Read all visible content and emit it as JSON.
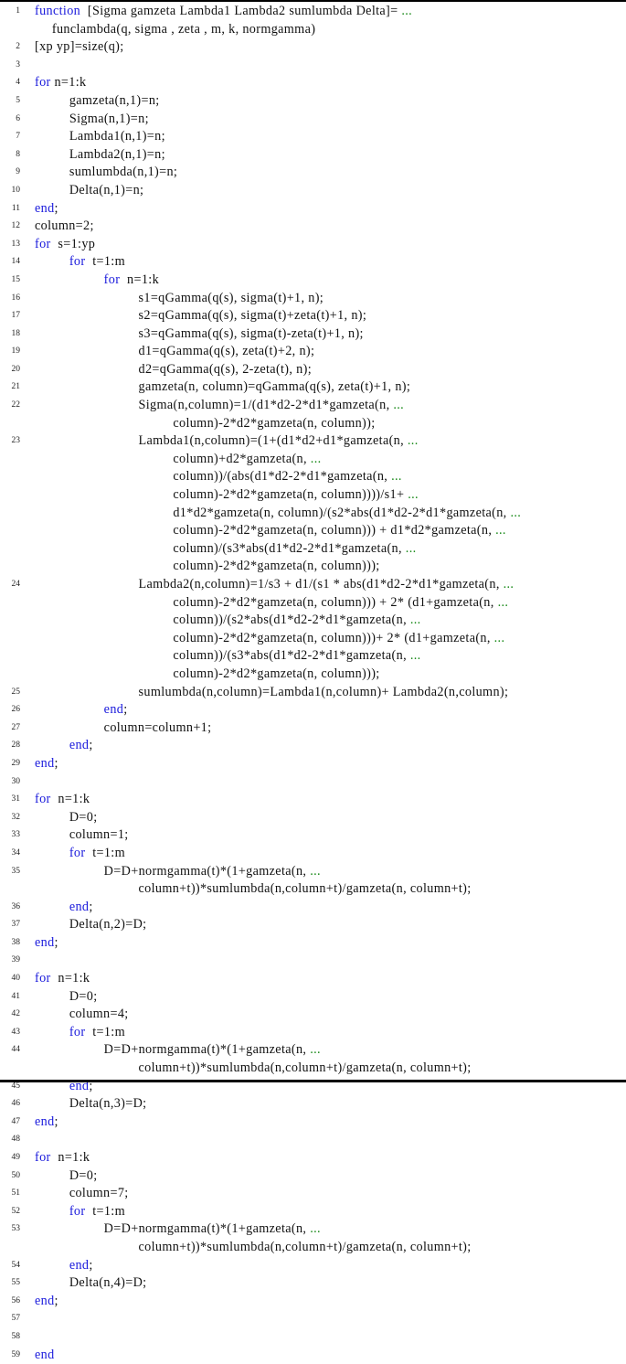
{
  "document": {
    "type": "code-listing",
    "language": "MATLAB",
    "colors": {
      "keyword": "#1a1adc",
      "continuation": "#1a8a1a",
      "text": "#111111"
    },
    "lines": [
      {
        "n": "1",
        "indent": 0,
        "segments": [
          {
            "t": "function",
            "k": "kw"
          },
          {
            "t": "  [Sigma gamzeta Lambda1 Lambda2 sumlumbda Delta]= "
          },
          {
            "t": "...",
            "k": "cont"
          }
        ]
      },
      {
        "n": "",
        "indent": 1,
        "segments": [
          {
            "t": "funclambda(q, sigma , zeta , m, k, normgamma)"
          }
        ]
      },
      {
        "n": "2",
        "indent": 0,
        "segments": [
          {
            "t": "[xp yp]=size(q);"
          }
        ]
      },
      {
        "n": "3",
        "indent": 0,
        "segments": []
      },
      {
        "n": "4",
        "indent": 0,
        "segments": [
          {
            "t": "for",
            "k": "kw"
          },
          {
            "t": " n=1:k"
          }
        ]
      },
      {
        "n": "5",
        "indent": 2,
        "segments": [
          {
            "t": "gamzeta(n,1)=n;"
          }
        ]
      },
      {
        "n": "6",
        "indent": 2,
        "segments": [
          {
            "t": "Sigma(n,1)=n;"
          }
        ]
      },
      {
        "n": "7",
        "indent": 2,
        "segments": [
          {
            "t": "Lambda1(n,1)=n;"
          }
        ]
      },
      {
        "n": "8",
        "indent": 2,
        "segments": [
          {
            "t": "Lambda2(n,1)=n;"
          }
        ]
      },
      {
        "n": "9",
        "indent": 2,
        "segments": [
          {
            "t": "sumlumbda(n,1)=n;"
          }
        ]
      },
      {
        "n": "10",
        "indent": 2,
        "segments": [
          {
            "t": "Delta(n,1)=n;"
          }
        ]
      },
      {
        "n": "11",
        "indent": 0,
        "segments": [
          {
            "t": "end",
            "k": "kw"
          },
          {
            "t": ";"
          }
        ]
      },
      {
        "n": "12",
        "indent": 0,
        "segments": [
          {
            "t": "column=2;"
          }
        ]
      },
      {
        "n": "13",
        "indent": 0,
        "segments": [
          {
            "t": "for",
            "k": "kw"
          },
          {
            "t": "  s=1:yp"
          }
        ]
      },
      {
        "n": "14",
        "indent": 2,
        "segments": [
          {
            "t": "for",
            "k": "kw"
          },
          {
            "t": "  t=1:m"
          }
        ]
      },
      {
        "n": "15",
        "indent": 4,
        "segments": [
          {
            "t": "for",
            "k": "kw"
          },
          {
            "t": "  n=1:k"
          }
        ]
      },
      {
        "n": "16",
        "indent": 6,
        "segments": [
          {
            "t": "s1=qGamma(q(s), sigma(t)+1, n);"
          }
        ]
      },
      {
        "n": "17",
        "indent": 6,
        "segments": [
          {
            "t": "s2=qGamma(q(s), sigma(t)+zeta(t)+1, n);"
          }
        ]
      },
      {
        "n": "18",
        "indent": 6,
        "segments": [
          {
            "t": "s3=qGamma(q(s), sigma(t)-zeta(t)+1, n);"
          }
        ]
      },
      {
        "n": "19",
        "indent": 6,
        "segments": [
          {
            "t": "d1=qGamma(q(s), zeta(t)+2, n);"
          }
        ]
      },
      {
        "n": "20",
        "indent": 6,
        "segments": [
          {
            "t": "d2=qGamma(q(s), 2-zeta(t), n);"
          }
        ]
      },
      {
        "n": "21",
        "indent": 6,
        "segments": [
          {
            "t": "gamzeta(n, column)=qGamma(q(s), zeta(t)+1, n);"
          }
        ]
      },
      {
        "n": "22",
        "indent": 6,
        "segments": [
          {
            "t": "Sigma(n,column)=1/(d1*d2-2*d1*gamzeta(n, "
          },
          {
            "t": "...",
            "k": "cont"
          }
        ]
      },
      {
        "n": "",
        "indent": 8,
        "segments": [
          {
            "t": "column)-2*d2*gamzeta(n, column));"
          }
        ]
      },
      {
        "n": "23",
        "indent": 6,
        "segments": [
          {
            "t": "Lambda1(n,column)=(1+(d1*d2+d1*gamzeta(n, "
          },
          {
            "t": "...",
            "k": "cont"
          }
        ]
      },
      {
        "n": "",
        "indent": 8,
        "segments": [
          {
            "t": "column)+d2*gamzeta(n, "
          },
          {
            "t": "...",
            "k": "cont"
          }
        ]
      },
      {
        "n": "",
        "indent": 8,
        "segments": [
          {
            "t": "column))/(abs(d1*d2-2*d1*gamzeta(n, "
          },
          {
            "t": "...",
            "k": "cont"
          }
        ]
      },
      {
        "n": "",
        "indent": 8,
        "segments": [
          {
            "t": "column)-2*d2*gamzeta(n, column))))/s1+ "
          },
          {
            "t": "...",
            "k": "cont"
          }
        ]
      },
      {
        "n": "",
        "indent": 8,
        "segments": [
          {
            "t": "d1*d2*gamzeta(n, column)/(s2*abs(d1*d2-2*d1*gamzeta(n, "
          },
          {
            "t": "...",
            "k": "cont"
          }
        ]
      },
      {
        "n": "",
        "indent": 8,
        "segments": [
          {
            "t": "column)-2*d2*gamzeta(n, column))) + d1*d2*gamzeta(n, "
          },
          {
            "t": "...",
            "k": "cont"
          }
        ]
      },
      {
        "n": "",
        "indent": 8,
        "segments": [
          {
            "t": "column)/(s3*abs(d1*d2-2*d1*gamzeta(n, "
          },
          {
            "t": "...",
            "k": "cont"
          }
        ]
      },
      {
        "n": "",
        "indent": 8,
        "segments": [
          {
            "t": "column)-2*d2*gamzeta(n, column)));"
          }
        ]
      },
      {
        "n": "24",
        "indent": 6,
        "segments": [
          {
            "t": "Lambda2(n,column)=1/s3 + d1/(s1 * abs(d1*d2-2*d1*gamzeta(n, "
          },
          {
            "t": "...",
            "k": "cont"
          }
        ]
      },
      {
        "n": "",
        "indent": 8,
        "segments": [
          {
            "t": "column)-2*d2*gamzeta(n, column))) + 2* (d1+gamzeta(n, "
          },
          {
            "t": "...",
            "k": "cont"
          }
        ]
      },
      {
        "n": "",
        "indent": 8,
        "segments": [
          {
            "t": "column))/(s2*abs(d1*d2-2*d1*gamzeta(n, "
          },
          {
            "t": "...",
            "k": "cont"
          }
        ]
      },
      {
        "n": "",
        "indent": 8,
        "segments": [
          {
            "t": "column)-2*d2*gamzeta(n, column)))+ 2* (d1+gamzeta(n, "
          },
          {
            "t": "...",
            "k": "cont"
          }
        ]
      },
      {
        "n": "",
        "indent": 8,
        "segments": [
          {
            "t": "column))/(s3*abs(d1*d2-2*d1*gamzeta(n, "
          },
          {
            "t": "...",
            "k": "cont"
          }
        ]
      },
      {
        "n": "",
        "indent": 8,
        "segments": [
          {
            "t": "column)-2*d2*gamzeta(n, column)));"
          }
        ]
      },
      {
        "n": "25",
        "indent": 6,
        "segments": [
          {
            "t": "sumlumbda(n,column)=Lambda1(n,column)+ Lambda2(n,column);"
          }
        ]
      },
      {
        "n": "26",
        "indent": 4,
        "segments": [
          {
            "t": "end",
            "k": "kw"
          },
          {
            "t": ";"
          }
        ]
      },
      {
        "n": "27",
        "indent": 4,
        "segments": [
          {
            "t": "column=column+1;"
          }
        ]
      },
      {
        "n": "28",
        "indent": 2,
        "segments": [
          {
            "t": "end",
            "k": "kw"
          },
          {
            "t": ";"
          }
        ]
      },
      {
        "n": "29",
        "indent": 0,
        "segments": [
          {
            "t": "end",
            "k": "kw"
          },
          {
            "t": ";"
          }
        ]
      },
      {
        "n": "30",
        "indent": 0,
        "segments": []
      },
      {
        "n": "31",
        "indent": 0,
        "segments": [
          {
            "t": "for",
            "k": "kw"
          },
          {
            "t": "  n=1:k"
          }
        ]
      },
      {
        "n": "32",
        "indent": 2,
        "segments": [
          {
            "t": "D=0;"
          }
        ]
      },
      {
        "n": "33",
        "indent": 2,
        "segments": [
          {
            "t": "column=1;"
          }
        ]
      },
      {
        "n": "34",
        "indent": 2,
        "segments": [
          {
            "t": "for",
            "k": "kw"
          },
          {
            "t": "  t=1:m"
          }
        ]
      },
      {
        "n": "35",
        "indent": 4,
        "segments": [
          {
            "t": "D=D+normgamma(t)*(1+gamzeta(n, "
          },
          {
            "t": "...",
            "k": "cont"
          }
        ]
      },
      {
        "n": "",
        "indent": 6,
        "segments": [
          {
            "t": "column+t))*sumlumbda(n,column+t)/gamzeta(n, column+t);"
          }
        ]
      },
      {
        "n": "36",
        "indent": 2,
        "segments": [
          {
            "t": "end",
            "k": "kw"
          },
          {
            "t": ";"
          }
        ]
      },
      {
        "n": "37",
        "indent": 2,
        "segments": [
          {
            "t": "Delta(n,2)=D;"
          }
        ]
      },
      {
        "n": "38",
        "indent": 0,
        "segments": [
          {
            "t": "end",
            "k": "kw"
          },
          {
            "t": ";"
          }
        ]
      },
      {
        "n": "39",
        "indent": 0,
        "segments": []
      },
      {
        "n": "40",
        "indent": 0,
        "segments": [
          {
            "t": "for",
            "k": "kw"
          },
          {
            "t": "  n=1:k"
          }
        ]
      },
      {
        "n": "41",
        "indent": 2,
        "segments": [
          {
            "t": "D=0;"
          }
        ]
      },
      {
        "n": "42",
        "indent": 2,
        "segments": [
          {
            "t": "column=4;"
          }
        ]
      },
      {
        "n": "43",
        "indent": 2,
        "segments": [
          {
            "t": "for",
            "k": "kw"
          },
          {
            "t": "  t=1:m"
          }
        ]
      },
      {
        "n": "44",
        "indent": 4,
        "segments": [
          {
            "t": "D=D+normgamma(t)*(1+gamzeta(n, "
          },
          {
            "t": "...",
            "k": "cont"
          }
        ]
      },
      {
        "n": "",
        "indent": 6,
        "segments": [
          {
            "t": "column+t))*sumlumbda(n,column+t)/gamzeta(n, column+t);"
          }
        ]
      },
      {
        "n": "45",
        "indent": 2,
        "segments": [
          {
            "t": "end",
            "k": "kw"
          },
          {
            "t": ";"
          }
        ]
      },
      {
        "n": "46",
        "indent": 2,
        "segments": [
          {
            "t": "Delta(n,3)=D;"
          }
        ]
      },
      {
        "n": "47",
        "indent": 0,
        "segments": [
          {
            "t": "end",
            "k": "kw"
          },
          {
            "t": ";"
          }
        ]
      },
      {
        "n": "48",
        "indent": 0,
        "segments": []
      },
      {
        "n": "49",
        "indent": 0,
        "segments": [
          {
            "t": "for",
            "k": "kw"
          },
          {
            "t": "  n=1:k"
          }
        ]
      },
      {
        "n": "50",
        "indent": 2,
        "segments": [
          {
            "t": "D=0;"
          }
        ]
      },
      {
        "n": "51",
        "indent": 2,
        "segments": [
          {
            "t": "column=7;"
          }
        ]
      },
      {
        "n": "52",
        "indent": 2,
        "segments": [
          {
            "t": "for",
            "k": "kw"
          },
          {
            "t": "  t=1:m"
          }
        ]
      },
      {
        "n": "53",
        "indent": 4,
        "segments": [
          {
            "t": "D=D+normgamma(t)*(1+gamzeta(n, "
          },
          {
            "t": "...",
            "k": "cont"
          }
        ]
      },
      {
        "n": "",
        "indent": 6,
        "segments": [
          {
            "t": "column+t))*sumlumbda(n,column+t)/gamzeta(n, column+t);"
          }
        ]
      },
      {
        "n": "54",
        "indent": 2,
        "segments": [
          {
            "t": "end",
            "k": "kw"
          },
          {
            "t": ";"
          }
        ]
      },
      {
        "n": "55",
        "indent": 2,
        "segments": [
          {
            "t": "Delta(n,4)=D;"
          }
        ]
      },
      {
        "n": "56",
        "indent": 0,
        "segments": [
          {
            "t": "end",
            "k": "kw"
          },
          {
            "t": ";"
          }
        ]
      },
      {
        "n": "57",
        "indent": 0,
        "segments": []
      },
      {
        "n": "58",
        "indent": 0,
        "segments": []
      },
      {
        "n": "59",
        "indent": 0,
        "segments": [
          {
            "t": "end",
            "k": "kw"
          }
        ]
      }
    ]
  }
}
